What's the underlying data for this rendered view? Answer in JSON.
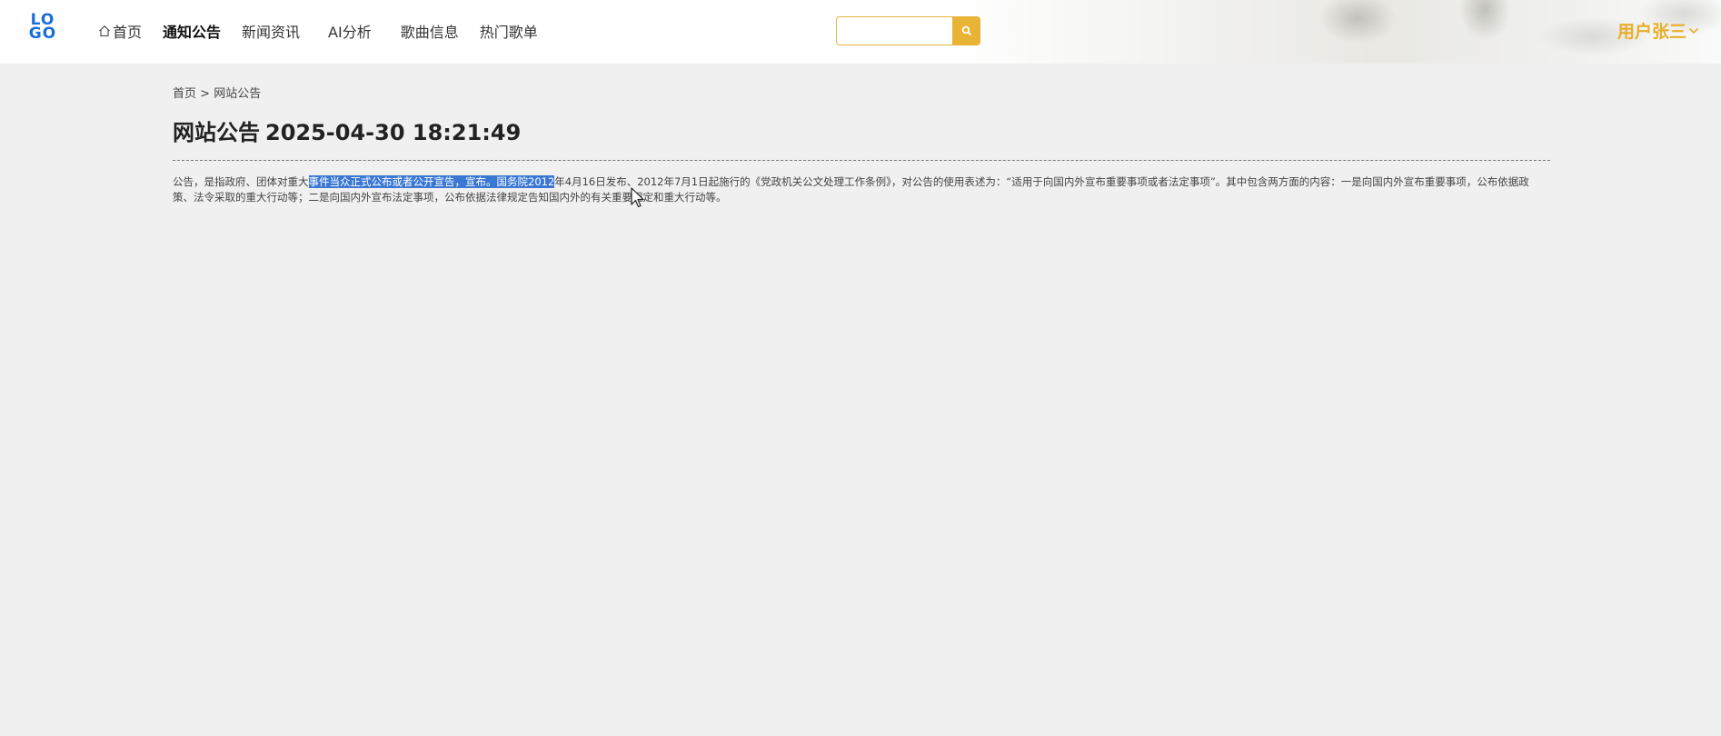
{
  "header": {
    "logo_line1": "LO",
    "logo_line2": "GO",
    "nav": [
      {
        "label": "首页",
        "active": false
      },
      {
        "label": "通知公告",
        "active": true
      },
      {
        "label": "新闻资讯",
        "active": false
      },
      {
        "label": "AI分析",
        "active": false
      },
      {
        "label": "歌曲信息",
        "active": false
      },
      {
        "label": "热门歌单",
        "active": false
      }
    ],
    "search": {
      "value": "",
      "placeholder": ""
    },
    "user_label": "用户张三"
  },
  "breadcrumb": {
    "home": "首页",
    "separator": ">",
    "current": "网站公告"
  },
  "article": {
    "title": "网站公告",
    "datetime": "2025-04-30 18:21:49",
    "text_before": "公告，是指政府、团体对重大",
    "text_selected": "事件当众正式公布或者公开宣告，宣布。国务院2012",
    "text_after": "年4月16日发布、2012年7月1日起施行的《党政机关公文处理工作条例》，对公告的使用表述为：“适用于向国内外宣布重要事项或者法定事项”。其中包含两方面的内容：一是向国内外宣布重要事项，公布依据政策、法令采取的重大行动等；二是向国内外宣布法定事项，公布依据法律规定告知国内外的有关重要规定和重大行动等。"
  },
  "colors": {
    "accent": "#e9b436",
    "user": "#e8ae2c",
    "selection": "#3a78d4",
    "logo": "#1a6fd6"
  }
}
